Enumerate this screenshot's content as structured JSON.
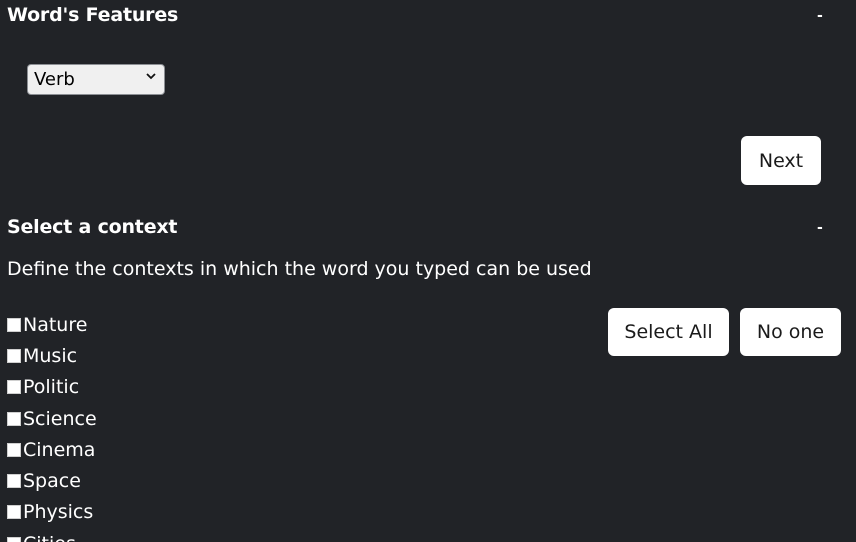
{
  "features": {
    "title": "Word's Features",
    "collapse_label": "-",
    "select": {
      "selected": "Verb",
      "options": [
        "Verb"
      ]
    },
    "next_label": "Next"
  },
  "context": {
    "title": "Select a context",
    "collapse_label": "-",
    "description": "Define the contexts in which the word you typed can be used",
    "select_all_label": "Select All",
    "no_one_label": "No one",
    "items": [
      {
        "label": "Nature",
        "checked": false
      },
      {
        "label": "Music",
        "checked": false
      },
      {
        "label": "Politic",
        "checked": false
      },
      {
        "label": "Science",
        "checked": false
      },
      {
        "label": "Cinema",
        "checked": false
      },
      {
        "label": "Space",
        "checked": false
      },
      {
        "label": "Physics",
        "checked": false
      },
      {
        "label": "Cities",
        "checked": false
      }
    ]
  }
}
